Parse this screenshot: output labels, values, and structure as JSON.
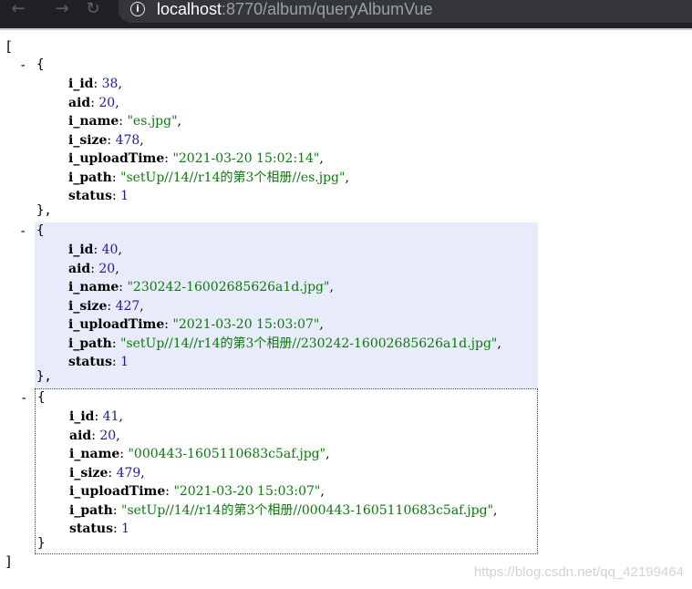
{
  "browser": {
    "url_host": "localhost",
    "url_rest": ":8770/album/queryAlbumVue",
    "icons": {
      "back": "arrow-left",
      "forward": "arrow-right",
      "reload": "reload",
      "info": "info"
    }
  },
  "json": {
    "open_bracket": "[",
    "close_bracket": "]",
    "collapse_glyph": "-",
    "objects": [
      {
        "i_id": "38",
        "aid": "20",
        "i_name": "\"es.jpg\"",
        "i_size": "478",
        "i_uploadTime": "\"2021-03-20 15:02:14\"",
        "i_path": "\"setUp//14//r14的第3个相册//es.jpg\"",
        "status": "1",
        "close": "},"
      },
      {
        "i_id": "40",
        "aid": "20",
        "i_name": "\"230242-16002685626a1d.jpg\"",
        "i_size": "427",
        "i_uploadTime": "\"2021-03-20 15:03:07\"",
        "i_path": "\"setUp//14//r14的第3个相册//230242-16002685626a1d.jpg\"",
        "status": "1",
        "close": "},"
      },
      {
        "i_id": "41",
        "aid": "20",
        "i_name": "\"000443-1605110683c5af.jpg\"",
        "i_size": "479",
        "i_uploadTime": "\"2021-03-20 15:03:07\"",
        "i_path": "\"setUp//14//r14的第3个相册//000443-1605110683c5af.jpg\"",
        "status": "1",
        "close": "}"
      }
    ],
    "keys": {
      "i_id": "i_id",
      "aid": "aid",
      "i_name": "i_name",
      "i_size": "i_size",
      "i_uploadTime": "i_uploadTime",
      "i_path": "i_path",
      "status": "status"
    }
  },
  "watermark": "https://blog.csdn.net/qq_42199464"
}
